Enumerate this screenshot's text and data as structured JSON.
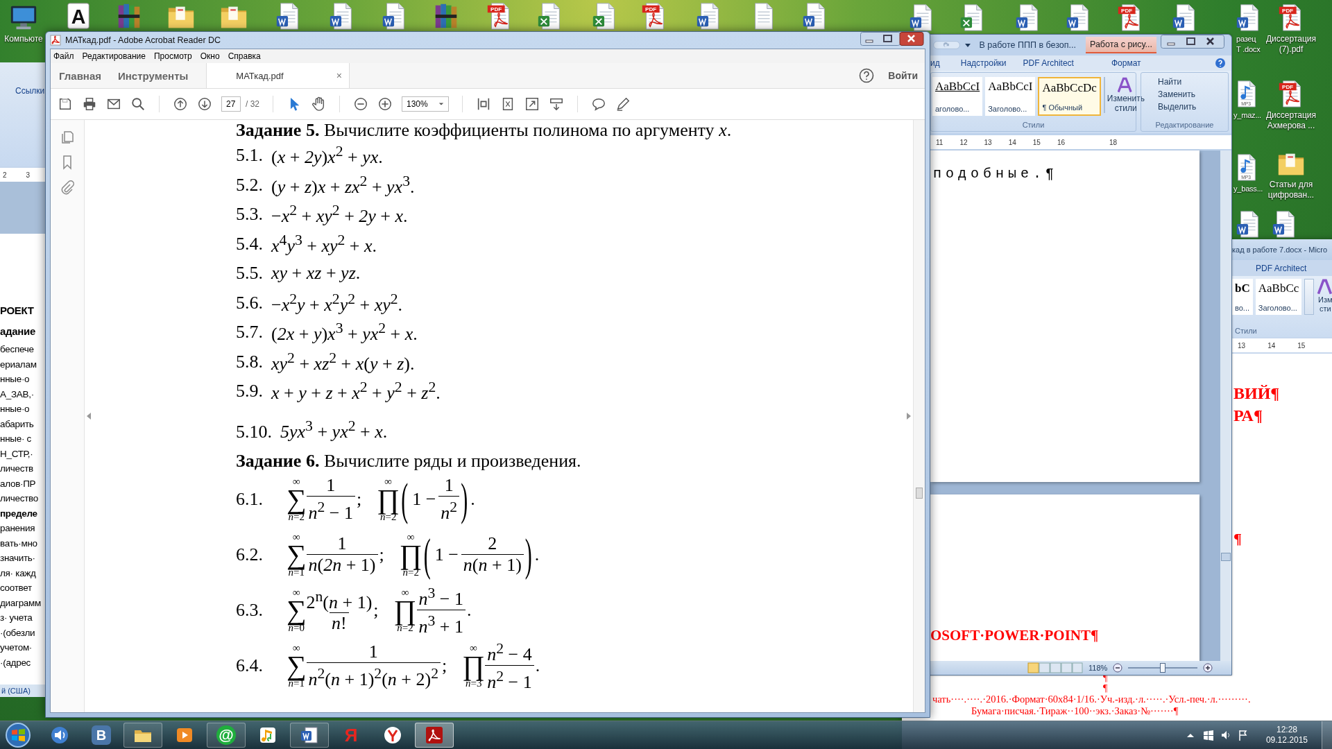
{
  "desktop_icons": [
    {
      "kind": "computer",
      "label": [
        "Компьюте"
      ]
    },
    {
      "kind": "app",
      "badge": "A"
    },
    {
      "kind": "archive"
    },
    {
      "kind": "folder"
    },
    {
      "kind": "folder"
    },
    {
      "kind": "word"
    },
    {
      "kind": "word"
    },
    {
      "kind": "word"
    },
    {
      "kind": "archive"
    },
    {
      "kind": "pdf",
      "badge": "PDF"
    },
    {
      "kind": "excel"
    },
    {
      "kind": "excel"
    },
    {
      "kind": "pdf",
      "badge": "PDF"
    },
    {
      "kind": "word"
    },
    {
      "kind": "blank"
    },
    {
      "kind": "word"
    },
    {
      "kind": "word"
    },
    {
      "kind": "excel"
    },
    {
      "kind": "word"
    },
    {
      "kind": "word"
    },
    {
      "kind": "pdf",
      "badge": "PDF"
    },
    {
      "kind": "word"
    },
    {
      "kind": "word",
      "label": [
        "разец",
        "T .docx"
      ]
    },
    {
      "kind": "pdf",
      "badge": "PDF",
      "label": [
        "Диссертация",
        "(7).pdf"
      ]
    },
    {
      "kind": "mp3",
      "badge": "MP3",
      "label": [
        "y_maz..."
      ]
    },
    {
      "kind": "pdf",
      "badge": "PDF",
      "label": [
        "Диссертация",
        "Ахмерова ..."
      ]
    },
    {
      "kind": "mp3",
      "badge": "MP3",
      "label": [
        "y_bass..."
      ]
    },
    {
      "kind": "folder",
      "label": [
        "Статьи для",
        "цифрован..."
      ]
    },
    {
      "kind": "word"
    },
    {
      "kind": "word"
    }
  ],
  "left_word": {
    "tab": "Ссылки",
    "ruler": [
      "2",
      "3"
    ],
    "lines": [
      {
        "text": "РОЕКТ",
        "bold": true
      },
      {
        "text": "адание",
        "bold": true
      },
      {
        "text": "беспече",
        "bold": false
      },
      {
        "text": "ериалам",
        "bold": false
      },
      {
        "text": "нные·о",
        "bold": false
      },
      {
        "text": "А_ЗАВ,·",
        "bold": false
      },
      {
        "text": "нные·о",
        "bold": false
      },
      {
        "text": "абарить",
        "bold": false
      },
      {
        "text": "нные· с",
        "bold": false
      },
      {
        "text": "Н_СТР,·",
        "bold": false
      },
      {
        "text": "личеств",
        "bold": false
      },
      {
        "text": "алов·ПР",
        "bold": false
      },
      {
        "text": "личество",
        "bold": false
      },
      {
        "text": "пределе",
        "bold": true
      },
      {
        "text": "ранения",
        "bold": false
      },
      {
        "text": "вать·мно",
        "bold": false
      },
      {
        "text": "значить·",
        "bold": false
      },
      {
        "text": "ля· кажд",
        "bold": false
      },
      {
        "text": "соответ",
        "bold": false
      },
      {
        "text": "диаграмм",
        "bold": false
      },
      {
        "text": "з· учета",
        "bold": false
      },
      {
        "text": "·(обезли",
        "bold": false
      },
      {
        "text": "учетом·",
        "bold": false
      },
      {
        "text": "·(адрес",
        "bold": false
      }
    ],
    "status": "й (США)"
  },
  "acrobat": {
    "title": "МАТкад.pdf - Adobe Acrobat Reader DC",
    "menu": [
      "Файл",
      "Редактирование",
      "Просмотр",
      "Окно",
      "Справка"
    ],
    "tabs": [
      {
        "label": "Главная",
        "selected": false
      },
      {
        "label": "Инструменты",
        "selected": false
      },
      {
        "label": "МАТкад.pdf",
        "selected": true,
        "close": "×"
      }
    ],
    "sign_in": "Войти",
    "page": "27",
    "page_total": "/ 32",
    "zoom": "130%",
    "tools": [
      {
        "kind": "select",
        "selected": true
      },
      {
        "kind": "hand",
        "selected": false
      }
    ],
    "tasks": [
      {
        "heading": "**Задание 5.** Вычислите коэффициенты полинома по аргументу *x*.",
        "items": [
          {
            "kind": "expr",
            "label": "5.1.",
            "expr": "(*x* + *2y*)*x*$^{2}$ + *yx*."
          },
          {
            "kind": "expr",
            "label": "5.2.",
            "expr": "(*y* + *z*)*x* + *zx*$^{2}$ + *yx*$^{3}$."
          },
          {
            "kind": "expr",
            "label": "5.3.",
            "expr": "−*x*$^{2}$ + *xy*$^{2}$ + *2y* + *x*."
          },
          {
            "kind": "expr",
            "label": "5.4.",
            "expr": "*x*$^{4}$*y*$^{3}$ + *xy*$^{2}$ + *x*."
          },
          {
            "kind": "expr",
            "label": "5.5.",
            "expr": "*xy* + *xz* + *yz*."
          },
          {
            "kind": "expr",
            "label": "5.6.",
            "expr": "−*x*$^{2}$*y* + *x*$^{2}$*y*$^{2}$ + *xy*$^{2}$."
          },
          {
            "kind": "expr",
            "label": "5.7.",
            "expr": "(*2x* + *y*)*x*$^{3}$ + *yx*$^{2}$ + *x*."
          },
          {
            "kind": "expr",
            "label": "5.8.",
            "expr": "*xy*$^{2}$ + *xz*$^{2}$ + *x*(*y* + *z*)."
          },
          {
            "kind": "expr",
            "label": "5.9.",
            "expr": "*x* + *y* + *z* + *x*$^{2}$ + *y*$^{2}$ + *z*$^{2}$."
          },
          {
            "kind": "expr",
            "label": "5.10.",
            "expr": "*5yx*$^{3}$ + *yx*$^{2}$ + *x*."
          }
        ]
      },
      {
        "heading": "**Задание 6.** Вычислите ряды и произведения.",
        "items": [
          {
            "kind": "series",
            "label": "6.1.",
            "terms": [
              {
                "op": "∑",
                "upper": "∞",
                "lower": "*n*=2",
                "num": "1",
                "den": "*n*$^{2}$ − 1",
                "sep": ";"
              },
              {
                "op": "∏",
                "upper": "∞",
                "lower": "*n*=2",
                "open": "(",
                "prefix": "1 −",
                "num": "1",
                "den": "*n*$^{2}$",
                "close": ")",
                "sep": "."
              }
            ]
          },
          {
            "kind": "series",
            "label": "6.2.",
            "terms": [
              {
                "op": "∑",
                "upper": "∞",
                "lower": "*n*=1",
                "num": "1",
                "den": "*n*(*2n* + 1)",
                "sep": ";"
              },
              {
                "op": "∏",
                "upper": "∞",
                "lower": "*n*=2",
                "open": "(",
                "prefix": "1 −",
                "num": "2",
                "den": "*n*(*n* + 1)",
                "close": ")",
                "sep": "."
              }
            ]
          },
          {
            "kind": "series",
            "label": "6.3.",
            "terms": [
              {
                "op": "∑",
                "upper": "∞",
                "lower": "*n*=0",
                "num": "2$^{n}$(*n* + 1)",
                "den": "*n*!",
                "sep": ";"
              },
              {
                "op": "∏",
                "upper": "∞",
                "lower": "*n*=2",
                "num": "*n*$^{3}$ − 1",
                "den": "*n*$^{3}$ + 1",
                "sep": "."
              }
            ]
          },
          {
            "kind": "series",
            "label": "6.4.",
            "terms": [
              {
                "op": "∑",
                "upper": "∞",
                "lower": "*n*=1",
                "num": "1",
                "den": "*n*$^{2}$(*n* + 1)$^{2}$(*n* + 2)$^{2}$",
                "sep": ";"
              },
              {
                "op": "∏",
                "upper": "∞",
                "lower": "*n*=3",
                "num": "*n*$^{2}$ − 4",
                "den": "*n*$^{2}$ − 1",
                "sep": "."
              }
            ]
          }
        ]
      }
    ]
  },
  "word": {
    "title": "В работе  ППП в безоп...",
    "context_tab": "Работа с рису...",
    "tabs": [
      "ид",
      "Надстройки",
      "PDF Architect",
      "Формат"
    ],
    "styles": [
      {
        "sample": "AaBbCcI",
        "name": "аголово...",
        "selected": false
      },
      {
        "sample": "AaBbCcI",
        "name": "Заголово...",
        "selected": false
      },
      {
        "sample": "AaBbCcDc",
        "name": "¶ Обычный",
        "selected": true
      }
    ],
    "change_styles": [
      "Изменить",
      "стили"
    ],
    "styles_group": "Стили",
    "edit": [
      "Найти",
      "Заменить",
      "Выделить"
    ],
    "edit_group": "Редактирование",
    "ruler": [
      "11",
      "12",
      "13",
      "14",
      "15",
      "16",
      "18"
    ],
    "text": "подобные.¶",
    "page2_text": "OSOFT·POWER·POINT¶",
    "zoom": "118%",
    "zoom_slider": {
      "level": 0.5
    }
  },
  "word_back": {
    "title": "кад в работе 7.docx - Micro",
    "tab": "PDF Architect",
    "styles": [
      {
        "sample": "bC",
        "name": "во..."
      },
      {
        "sample": "AaBbCc",
        "name": "Заголово..."
      }
    ],
    "change_styles": [
      "Изм",
      "сти"
    ],
    "styles_group": "Стили",
    "ruler": [
      "13",
      "14",
      "15"
    ],
    "lines": [
      "ВИЙ¶",
      "РА¶",
      "¶",
      "¶",
      "¶",
      "чать····.····.·2016.·Формат·60x84·1/16.·Уч.-изд.·л.·····.·Усл.-печ.·л.·········.",
      "Бумага·писчая.·Тираж··100··экз.·Заказ·№·······¶"
    ]
  },
  "taskbar": {
    "apps": [
      {
        "kind": "speaker",
        "running": false,
        "selected": false
      },
      {
        "kind": "vk",
        "glyph": "В",
        "running": false,
        "selected": false
      },
      {
        "kind": "folder",
        "running": true,
        "selected": false
      },
      {
        "kind": "media",
        "running": false,
        "selected": false
      },
      {
        "kind": "mail",
        "glyph": "@",
        "running": true,
        "selected": false
      },
      {
        "kind": "music",
        "running": false,
        "selected": false
      },
      {
        "kind": "word",
        "running": true,
        "selected": false
      },
      {
        "kind": "yandex",
        "glyph": "Я",
        "running": false,
        "selected": false
      },
      {
        "kind": "browser",
        "running": false,
        "selected": false
      },
      {
        "kind": "acrobat",
        "running": true,
        "selected": true
      }
    ],
    "time": "12:28",
    "date": "09.12.2015"
  }
}
